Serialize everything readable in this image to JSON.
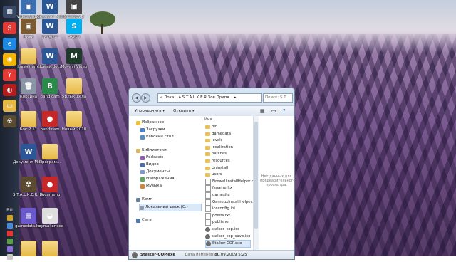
{
  "desktop": {
    "icons": [
      {
        "label": "VideoTool01",
        "glyph": "▣",
        "color": "#3c6fb0"
      },
      {
        "label": "Документ Microsoft...",
        "glyph": "W",
        "color": "#2b5797"
      },
      {
        "label": "VideoDVD",
        "glyph": "▣",
        "color": "#444444"
      },
      {
        "label": "Киви",
        "glyph": "▣",
        "color": "#7a5a30"
      },
      {
        "label": "титулос",
        "glyph": "W",
        "color": "#2b5797"
      },
      {
        "label": "Skype",
        "glyph": "S",
        "color": "#00aff0"
      },
      {
        "label": "Новая папка",
        "glyph": "",
        "color": "#e6b845"
      },
      {
        "label": "Новый.docx",
        "glyph": "W",
        "color": "#2b5797"
      },
      {
        "label": "Movavi Video",
        "glyph": "M",
        "color": "#1f3b2c"
      },
      {
        "label": "Корзина",
        "glyph": "🗑",
        "color": "#8a96a6"
      },
      {
        "label": "Bandicam",
        "glyph": "B",
        "color": "#2a8a4a"
      },
      {
        "label": "Ярлык дела",
        "glyph": "",
        "color": "#e6b845"
      },
      {
        "label": "Бок 2.11",
        "glyph": "",
        "color": "#e6b845"
      },
      {
        "label": "bandicam",
        "glyph": "●",
        "color": "#c62828"
      },
      {
        "label": "Новый 2018",
        "glyph": "",
        "color": "#e6b845"
      },
      {
        "label": "Документ Microsoft...",
        "glyph": "W",
        "color": "#2b5797"
      },
      {
        "label": "Програм...",
        "glyph": "",
        "color": "#e6b845"
      },
      {
        "label": "S.T.A.L.K.E.R. Припять...",
        "glyph": "☢",
        "color": "#5a4a30"
      },
      {
        "label": "bocamenu",
        "glyph": "●",
        "color": "#c62828"
      },
      {
        "label": "gamedata.rar",
        "glyph": "▤",
        "color": "#6a5acd"
      },
      {
        "label": "keymaker.exe",
        "glyph": "◒",
        "color": "#dddddd"
      },
      {
        "label": "",
        "glyph": "",
        "color": "#e6b845"
      },
      {
        "label": "",
        "glyph": "",
        "color": "#e6b845"
      }
    ]
  },
  "taskbar": {
    "buttons": [
      {
        "name": "start-button",
        "glyph": "▦",
        "color": "#3a4a66"
      },
      {
        "name": "yandex-browser",
        "glyph": "Я",
        "color": "#e53935"
      },
      {
        "name": "ie-browser",
        "glyph": "e",
        "color": "#1e88e5"
      },
      {
        "name": "chrome-browser",
        "glyph": "◉",
        "color": "#f4b400"
      },
      {
        "name": "yandex-app",
        "glyph": "Y",
        "color": "#e53935"
      },
      {
        "name": "media-app",
        "glyph": "◐",
        "color": "#b71c1c"
      },
      {
        "name": "explorer-app",
        "glyph": "▭",
        "color": "#e6b845"
      },
      {
        "name": "stalker-app",
        "glyph": "☢",
        "color": "#5a4a30"
      }
    ],
    "tray": {
      "lang": "RU"
    }
  },
  "explorer": {
    "address": "« Лока... ▸ S.T.A.L.K.E.R.Зов Припя... ▸",
    "search_placeholder": "Поиск: S.T...",
    "toolbar": {
      "organize": "Упорядочить ▾",
      "open": "Открыть ▾"
    },
    "nav": {
      "favorites": "Избранное",
      "fav_items": [
        "Загрузки",
        "Рабочий стол"
      ],
      "libraries": "Библиотеки",
      "lib_items": [
        "Podcasts",
        "Видео",
        "Документы",
        "Изображения",
        "Музыка"
      ],
      "computer": "Комп",
      "computer_items": [
        "Локальный диск (C:)"
      ],
      "network": "Сеть"
    },
    "files": {
      "header": "Имя",
      "items": [
        {
          "name": "bin",
          "kind": "folder"
        },
        {
          "name": "gamedata",
          "kind": "folder"
        },
        {
          "name": "levels",
          "kind": "folder"
        },
        {
          "name": "localization",
          "kind": "folder"
        },
        {
          "name": "patches",
          "kind": "folder"
        },
        {
          "name": "resources",
          "kind": "folder"
        },
        {
          "name": "Uninstall",
          "kind": "folder"
        },
        {
          "name": "users",
          "kind": "folder"
        },
        {
          "name": "FirewallInstallHelper.dll",
          "kind": "file"
        },
        {
          "name": "fsgame.ltx",
          "kind": "file"
        },
        {
          "name": "gamesite",
          "kind": "file"
        },
        {
          "name": "GameuxInstallHelper.dll",
          "kind": "file"
        },
        {
          "name": "iceconfig.ini",
          "kind": "file"
        },
        {
          "name": "points.txt",
          "kind": "file"
        },
        {
          "name": "publisher",
          "kind": "file"
        },
        {
          "name": "stalker_cop.ico",
          "kind": "exe"
        },
        {
          "name": "stalker_cop_save.ico",
          "kind": "exe"
        },
        {
          "name": "Stalker-COP.exe",
          "kind": "exe",
          "selected": true
        }
      ]
    },
    "preview_text": "Нет данных для предварительного просмотра.",
    "details": {
      "name": "Stalker-COP.exe",
      "date_label": "Дата изменения:",
      "date": "30.09.2009 5:25"
    }
  }
}
